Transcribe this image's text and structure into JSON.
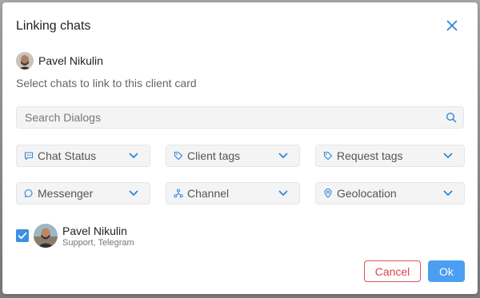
{
  "dialog": {
    "title": "Linking chats",
    "close_icon": "close-icon"
  },
  "client": {
    "name": "Pavel Nikulin",
    "avatar_icon": "user-avatar"
  },
  "subtitle": "Select chats to link to this client card",
  "search": {
    "placeholder": "Search Dialogs",
    "value": "",
    "icon": "search-icon"
  },
  "filters": [
    {
      "label": "Chat Status",
      "icon": "chat-status-icon"
    },
    {
      "label": "Client tags",
      "icon": "tag-icon"
    },
    {
      "label": "Request tags",
      "icon": "tag-icon"
    },
    {
      "label": "Messenger",
      "icon": "message-bubble-icon"
    },
    {
      "label": "Channel",
      "icon": "channel-icon"
    },
    {
      "label": "Geolocation",
      "icon": "location-pin-icon"
    }
  ],
  "chats": [
    {
      "name": "Pavel Nikulin",
      "subtitle": "Support, Telegram",
      "checked": true
    }
  ],
  "actions": {
    "cancel_label": "Cancel",
    "ok_label": "Ok"
  },
  "colors": {
    "accent": "#4b9ef0",
    "icon_blue": "#2f86d8",
    "danger": "#d9454e"
  }
}
